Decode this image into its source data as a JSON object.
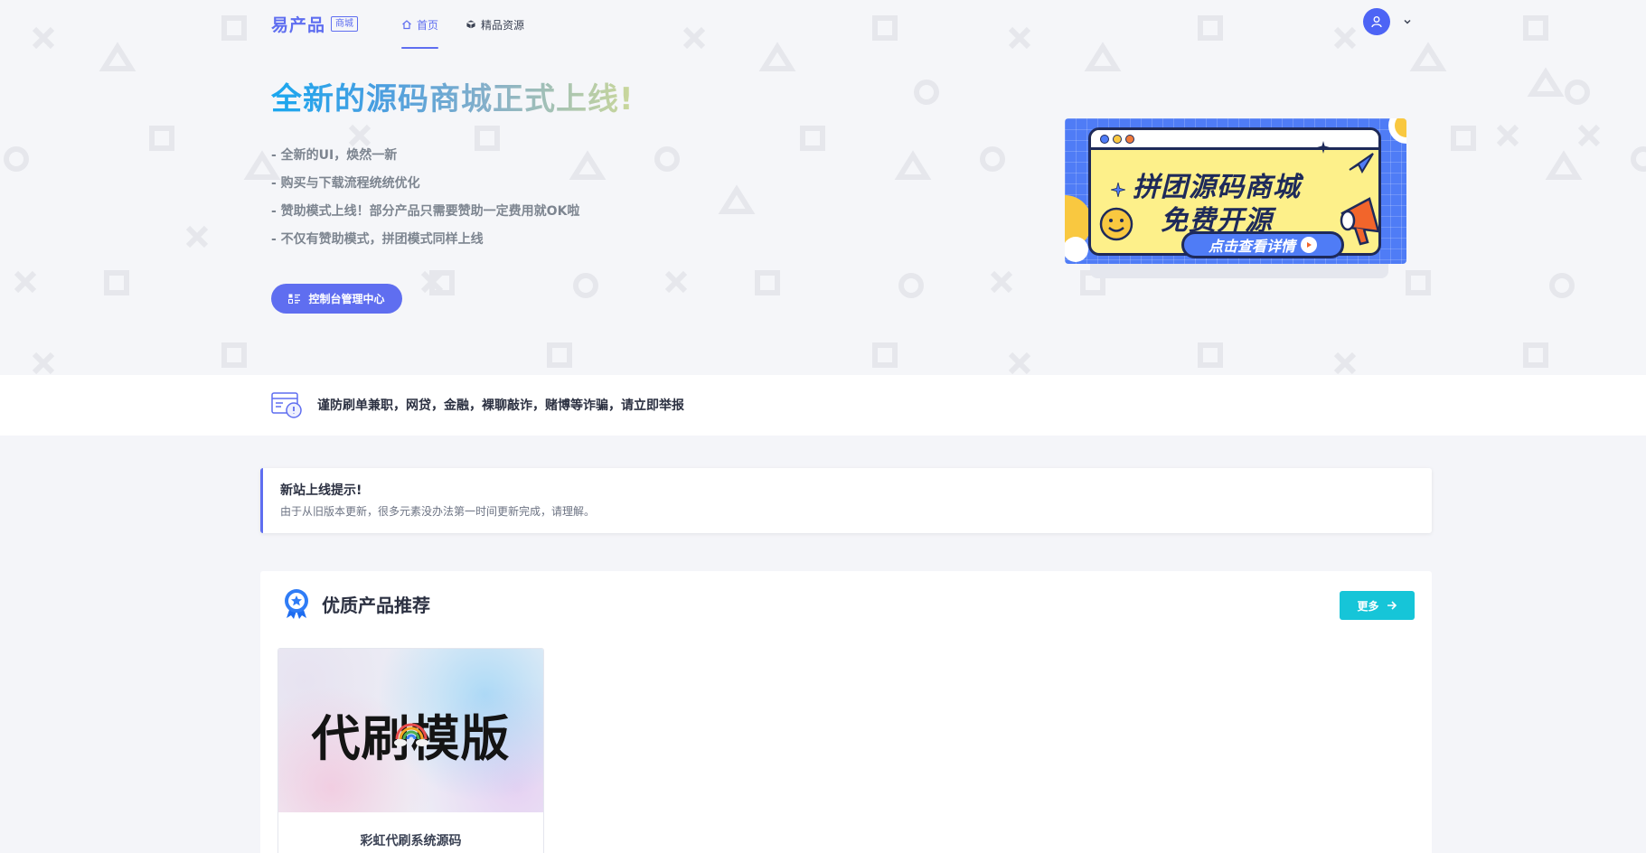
{
  "header": {
    "logo_text": "易产品",
    "logo_badge": "商城",
    "nav": [
      {
        "label": "首页",
        "icon": "home-icon",
        "active": true
      },
      {
        "label": "精品资源",
        "icon": "cube-icon",
        "active": false
      }
    ],
    "user_icon": "user-icon",
    "dropdown_icon": "chevron-down-icon"
  },
  "hero": {
    "title": "全新的源码商城正式上线!",
    "features": [
      "- 全新的UI，焕然一新",
      "- 购买与下载流程统统优化",
      "- 赞助模式上线！部分产品只需要赞助一定费用就OK啦",
      "- 不仅有赞助模式，拼团模式同样上线"
    ],
    "console_button": "控制台管理中心",
    "banner": {
      "line1": "拼团源码商城",
      "line2": "免费开源",
      "cta": "点击查看详情"
    }
  },
  "notice": {
    "text": "谨防刷单兼职，网贷，金融，裸聊敲诈，赌博等诈骗，请立即举报",
    "icon": "warning-card-icon"
  },
  "alert": {
    "title": "新站上线提示!",
    "body": "由于从旧版本更新，很多元素没办法第一时间更新完成，请理解。"
  },
  "products": {
    "title": "优质产品推荐",
    "more_label": "更多",
    "icon": "award-badge-icon",
    "items": [
      {
        "thumb_text": "代刷模版",
        "name": "彩虹代刷系统源码"
      }
    ]
  },
  "colors": {
    "primary": "#5f6ef0",
    "cyan": "#16c5d8",
    "banner_blue": "#4f7cf6",
    "banner_yellow": "#fdf08a"
  }
}
